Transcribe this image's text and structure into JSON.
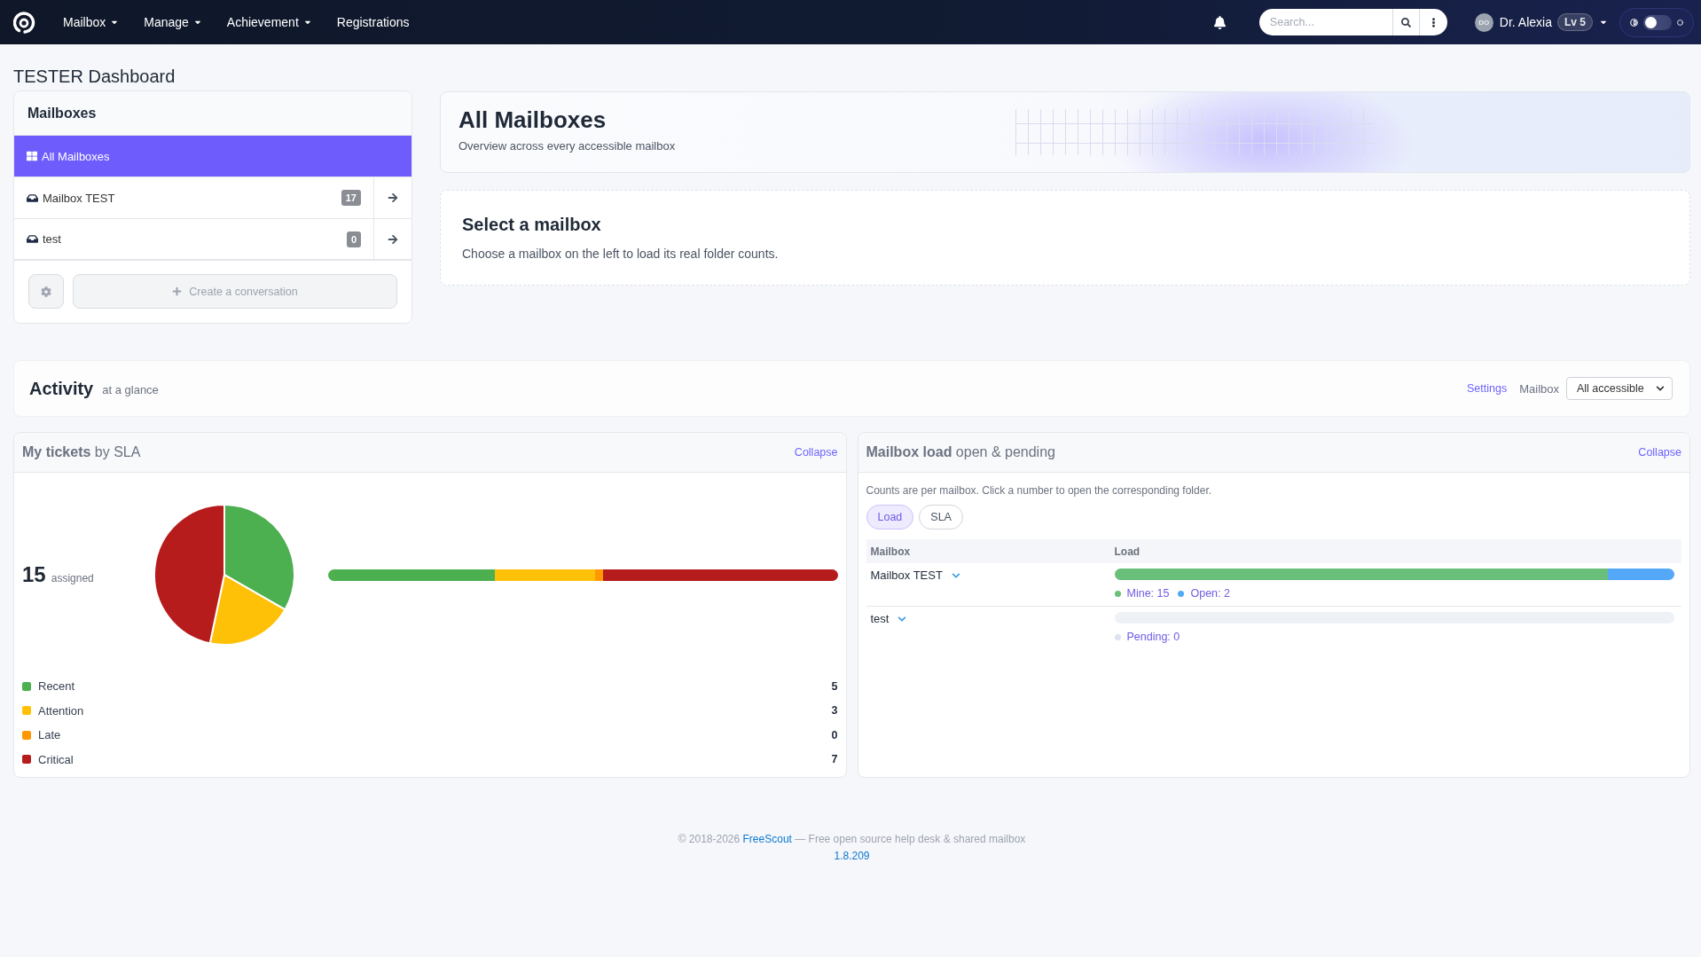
{
  "navbar": {
    "menu": [
      {
        "label": "Mailbox",
        "dropdown": true
      },
      {
        "label": "Manage",
        "dropdown": true
      },
      {
        "label": "Achievement",
        "dropdown": true
      },
      {
        "label": "Registrations",
        "dropdown": false
      }
    ],
    "search": {
      "placeholder": "Search..."
    },
    "user": {
      "initials": "DO",
      "name": "Dr. Alexia",
      "level_badge": "Lv 5"
    },
    "theme_toggle": {
      "on": false
    }
  },
  "page_title": "TESTER Dashboard",
  "mailboxes_panel": {
    "title": "Mailboxes",
    "items": [
      {
        "kind": "all",
        "label": "All Mailboxes",
        "selected": true
      },
      {
        "kind": "mailbox",
        "label": "Mailbox TEST",
        "count": "17",
        "selected": false
      },
      {
        "kind": "mailbox",
        "label": "test",
        "count": "0",
        "selected": false
      }
    ],
    "create_button": "Create a conversation"
  },
  "overview": {
    "title": "All Mailboxes",
    "subtitle": "Overview across every accessible mailbox"
  },
  "select_prompt": {
    "title": "Select a mailbox",
    "text": "Choose a mailbox on the left to load its real folder counts."
  },
  "activity": {
    "title": "Activity",
    "subtitle": "at a glance",
    "settings_link": "Settings",
    "mailbox_label": "Mailbox",
    "mailbox_select": "All accessible"
  },
  "my_tickets": {
    "title": "**My tickets** by SLA",
    "collapse": "Collapse",
    "total": "15",
    "total_label": "assigned",
    "chart_data": {
      "type": "pie",
      "categories": [
        "Recent",
        "Attention",
        "Late",
        "Critical"
      ],
      "values": [
        33.3,
        20,
        0,
        46.7
      ]
    },
    "legend": [
      {
        "count": "5",
        "color": "#4caf50"
      },
      {
        "count": "3",
        "color": "#ffc107"
      },
      {
        "count": "0",
        "color": "#ff9800"
      },
      {
        "count": "7",
        "color": "#b71c1c"
      }
    ]
  },
  "mailbox_load": {
    "title": "**Mailbox load** open & pending",
    "collapse": "Collapse",
    "note": "Counts are per mailbox. Click a number to open the corresponding folder.",
    "view_tabs": [
      {
        "label": "Load",
        "selected": true
      },
      {
        "label": "SLA",
        "selected": false
      }
    ],
    "table": {
      "columns": [
        "Mailbox",
        "Load"
      ],
      "rows": [
        {
          "mailbox": "Mailbox TEST",
          "segments": [
            {
              "label": "Mine: 15",
              "color": "#6abf7b",
              "level": 0.882
            },
            {
              "label": "Open: 2",
              "color": "#55a8f7",
              "level": 0.118
            }
          ]
        },
        {
          "mailbox": "test",
          "segments": [
            {
              "label": "Pending: 0",
              "color": "#dde3ec"
            }
          ]
        }
      ]
    }
  },
  "footer": {
    "copyright": "© 2018-2026",
    "link": "FreeScout",
    "tagline": "— Free open source help desk & shared mailbox",
    "version": "1.8.209"
  }
}
